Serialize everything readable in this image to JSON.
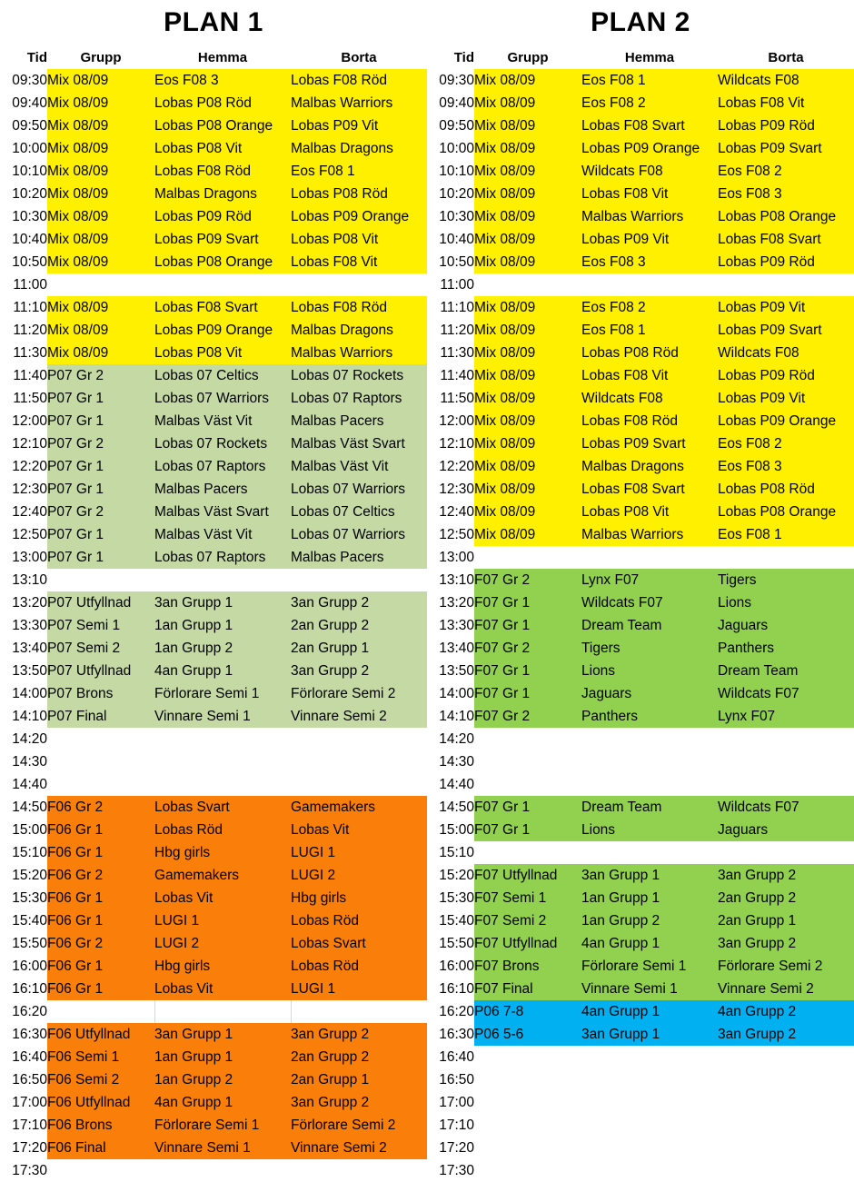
{
  "columns": {
    "tid": "Tid",
    "grupp": "Grupp",
    "hemma": "Hemma",
    "borta": "Borta"
  },
  "colors": {
    "yellow": "#FFF000",
    "sage_green": "#C5D9A5",
    "bright_green": "#92D14F",
    "orange": "#FA7E0A",
    "blue": "#00B0F0",
    "empty": "#FFFFFF"
  },
  "plans": [
    {
      "title": "PLAN 1",
      "rows": [
        {
          "tid": "09:30",
          "grupp": "Mix 08/09",
          "hemma": "Eos F08 3",
          "borta": "Lobas F08 Röd",
          "fill": "yellow"
        },
        {
          "tid": "09:40",
          "grupp": "Mix 08/09",
          "hemma": "Lobas P08 Röd",
          "borta": "Malbas Warriors",
          "fill": "yellow"
        },
        {
          "tid": "09:50",
          "grupp": "Mix 08/09",
          "hemma": "Lobas P08 Orange",
          "borta": "Lobas P09 Vit",
          "fill": "yellow"
        },
        {
          "tid": "10:00",
          "grupp": "Mix 08/09",
          "hemma": "Lobas P08 Vit",
          "borta": "Malbas Dragons",
          "fill": "yellow"
        },
        {
          "tid": "10:10",
          "grupp": "Mix 08/09",
          "hemma": "Lobas F08 Röd",
          "borta": "Eos F08 1",
          "fill": "yellow"
        },
        {
          "tid": "10:20",
          "grupp": "Mix 08/09",
          "hemma": "Malbas Dragons",
          "borta": "Lobas P08 Röd",
          "fill": "yellow"
        },
        {
          "tid": "10:30",
          "grupp": "Mix 08/09",
          "hemma": "Lobas P09 Röd",
          "borta": "Lobas P09 Orange",
          "fill": "yellow"
        },
        {
          "tid": "10:40",
          "grupp": "Mix 08/09",
          "hemma": "Lobas P09 Svart",
          "borta": "Lobas P08 Vit",
          "fill": "yellow"
        },
        {
          "tid": "10:50",
          "grupp": "Mix 08/09",
          "hemma": "Lobas P08 Orange",
          "borta": "Lobas F08 Vit",
          "fill": "yellow"
        },
        {
          "tid": "11:00",
          "grupp": "",
          "hemma": "",
          "borta": "",
          "fill": "none"
        },
        {
          "tid": "11:10",
          "grupp": "Mix 08/09",
          "hemma": "Lobas F08 Svart",
          "borta": "Lobas F08 Röd",
          "fill": "yellow"
        },
        {
          "tid": "11:20",
          "grupp": "Mix 08/09",
          "hemma": "Lobas P09 Orange",
          "borta": "Malbas Dragons",
          "fill": "yellow"
        },
        {
          "tid": "11:30",
          "grupp": "Mix 08/09",
          "hemma": "Lobas P08 Vit",
          "borta": "Malbas Warriors",
          "fill": "yellow"
        },
        {
          "tid": "11:40",
          "grupp": "P07 Gr 2",
          "hemma": "Lobas 07 Celtics",
          "borta": "Lobas 07 Rockets",
          "fill": "sage"
        },
        {
          "tid": "11:50",
          "grupp": "P07 Gr 1",
          "hemma": "Lobas 07 Warriors",
          "borta": "Lobas 07 Raptors",
          "fill": "sage"
        },
        {
          "tid": "12:00",
          "grupp": "P07 Gr 1",
          "hemma": "Malbas Väst Vit",
          "borta": "Malbas Pacers",
          "fill": "sage"
        },
        {
          "tid": "12:10",
          "grupp": "P07 Gr 2",
          "hemma": "Lobas 07 Rockets",
          "borta": "Malbas Väst Svart",
          "fill": "sage"
        },
        {
          "tid": "12:20",
          "grupp": "P07 Gr 1",
          "hemma": "Lobas 07 Raptors",
          "borta": "Malbas Väst Vit",
          "fill": "sage"
        },
        {
          "tid": "12:30",
          "grupp": "P07 Gr 1",
          "hemma": "Malbas Pacers",
          "borta": "Lobas 07 Warriors",
          "fill": "sage"
        },
        {
          "tid": "12:40",
          "grupp": "P07 Gr 2",
          "hemma": "Malbas Väst Svart",
          "borta": "Lobas 07 Celtics",
          "fill": "sage"
        },
        {
          "tid": "12:50",
          "grupp": "P07 Gr 1",
          "hemma": "Malbas Väst Vit",
          "borta": "Lobas 07 Warriors",
          "fill": "sage"
        },
        {
          "tid": "13:00",
          "grupp": "P07 Gr 1",
          "hemma": "Lobas 07 Raptors",
          "borta": "Malbas Pacers",
          "fill": "sage"
        },
        {
          "tid": "13:10",
          "grupp": "",
          "hemma": "",
          "borta": "",
          "fill": "none"
        },
        {
          "tid": "13:20",
          "grupp": "P07 Utfyllnad",
          "hemma": "3an Grupp 1",
          "borta": "3an Grupp 2",
          "fill": "sage"
        },
        {
          "tid": "13:30",
          "grupp": "P07 Semi 1",
          "hemma": "1an Grupp 1",
          "borta": "2an Grupp 2",
          "fill": "sage"
        },
        {
          "tid": "13:40",
          "grupp": "P07 Semi 2",
          "hemma": "1an Grupp 2",
          "borta": "2an Grupp 1",
          "fill": "sage"
        },
        {
          "tid": "13:50",
          "grupp": "P07 Utfyllnad",
          "hemma": "4an Grupp 1",
          "borta": "3an Grupp 2",
          "fill": "sage"
        },
        {
          "tid": "14:00",
          "grupp": "P07 Brons",
          "hemma": "Förlorare Semi 1",
          "borta": "Förlorare Semi 2",
          "fill": "sage"
        },
        {
          "tid": "14:10",
          "grupp": "P07 Final",
          "hemma": "Vinnare Semi 1",
          "borta": "Vinnare Semi 2",
          "fill": "sage"
        },
        {
          "tid": "14:20",
          "grupp": "",
          "hemma": "",
          "borta": "",
          "fill": "none"
        },
        {
          "tid": "14:30",
          "grupp": "",
          "hemma": "",
          "borta": "",
          "fill": "none"
        },
        {
          "tid": "14:40",
          "grupp": "",
          "hemma": "",
          "borta": "",
          "fill": "none"
        },
        {
          "tid": "14:50",
          "grupp": "F06 Gr 2",
          "hemma": "Lobas Svart",
          "borta": "Gamemakers",
          "fill": "orange"
        },
        {
          "tid": "15:00",
          "grupp": "F06 Gr 1",
          "hemma": "Lobas Röd",
          "borta": "Lobas Vit",
          "fill": "orange"
        },
        {
          "tid": "15:10",
          "grupp": "F06 Gr 1",
          "hemma": "Hbg girls",
          "borta": "LUGI 1",
          "fill": "orange"
        },
        {
          "tid": "15:20",
          "grupp": "F06 Gr 2",
          "hemma": "Gamemakers",
          "borta": "LUGI 2",
          "fill": "orange"
        },
        {
          "tid": "15:30",
          "grupp": "F06 Gr 1",
          "hemma": "Lobas Vit",
          "borta": "Hbg girls",
          "fill": "orange"
        },
        {
          "tid": "15:40",
          "grupp": "F06 Gr 1",
          "hemma": "LUGI 1",
          "borta": "Lobas Röd",
          "fill": "orange"
        },
        {
          "tid": "15:50",
          "grupp": "F06 Gr 2",
          "hemma": "LUGI 2",
          "borta": "Lobas Svart",
          "fill": "orange"
        },
        {
          "tid": "16:00",
          "grupp": "F06 Gr 1",
          "hemma": "Hbg girls",
          "borta": "Lobas Röd",
          "fill": "orange"
        },
        {
          "tid": "16:10",
          "grupp": "F06 Gr 1",
          "hemma": "Lobas Vit",
          "borta": "LUGI 1",
          "fill": "orange"
        },
        {
          "tid": "16:20",
          "grupp": "",
          "hemma": "",
          "borta": "",
          "fill": "none",
          "sep": true
        },
        {
          "tid": "16:30",
          "grupp": "F06 Utfyllnad",
          "hemma": "3an Grupp 1",
          "borta": "3an Grupp 2",
          "fill": "orange"
        },
        {
          "tid": "16:40",
          "grupp": "F06 Semi 1",
          "hemma": "1an Grupp 1",
          "borta": "2an Grupp 2",
          "fill": "orange"
        },
        {
          "tid": "16:50",
          "grupp": "F06 Semi 2",
          "hemma": "1an Grupp 2",
          "borta": "2an Grupp 1",
          "fill": "orange"
        },
        {
          "tid": "17:00",
          "grupp": "F06 Utfyllnad",
          "hemma": "4an Grupp 1",
          "borta": "3an Grupp 2",
          "fill": "orange"
        },
        {
          "tid": "17:10",
          "grupp": "F06 Brons",
          "hemma": "Förlorare Semi 1",
          "borta": "Förlorare Semi 2",
          "fill": "orange"
        },
        {
          "tid": "17:20",
          "grupp": "F06 Final",
          "hemma": "Vinnare Semi 1",
          "borta": "Vinnare Semi 2",
          "fill": "orange"
        },
        {
          "tid": "17:30",
          "grupp": "",
          "hemma": "",
          "borta": "",
          "fill": "none"
        }
      ]
    },
    {
      "title": "PLAN 2",
      "rows": [
        {
          "tid": "09:30",
          "grupp": "Mix 08/09",
          "hemma": "Eos F08 1",
          "borta": "Wildcats F08",
          "fill": "yellow"
        },
        {
          "tid": "09:40",
          "grupp": "Mix 08/09",
          "hemma": "Eos F08 2",
          "borta": "Lobas F08 Vit",
          "fill": "yellow"
        },
        {
          "tid": "09:50",
          "grupp": "Mix 08/09",
          "hemma": "Lobas F08 Svart",
          "borta": "Lobas P09 Röd",
          "fill": "yellow"
        },
        {
          "tid": "10:00",
          "grupp": "Mix 08/09",
          "hemma": "Lobas P09 Orange",
          "borta": "Lobas P09 Svart",
          "fill": "yellow"
        },
        {
          "tid": "10:10",
          "grupp": "Mix 08/09",
          "hemma": "Wildcats F08",
          "borta": "Eos F08 2",
          "fill": "yellow"
        },
        {
          "tid": "10:20",
          "grupp": "Mix 08/09",
          "hemma": "Lobas F08 Vit",
          "borta": "Eos F08 3",
          "fill": "yellow"
        },
        {
          "tid": "10:30",
          "grupp": "Mix 08/09",
          "hemma": "Malbas Warriors",
          "borta": "Lobas P08 Orange",
          "fill": "yellow"
        },
        {
          "tid": "10:40",
          "grupp": "Mix 08/09",
          "hemma": "Lobas P09 Vit",
          "borta": "Lobas F08 Svart",
          "fill": "yellow"
        },
        {
          "tid": "10:50",
          "grupp": "Mix 08/09",
          "hemma": "Eos F08 3",
          "borta": "Lobas P09 Röd",
          "fill": "yellow"
        },
        {
          "tid": "11:00",
          "grupp": "",
          "hemma": "",
          "borta": "",
          "fill": "none"
        },
        {
          "tid": "11:10",
          "grupp": "Mix 08/09",
          "hemma": "Eos F08 2",
          "borta": "Lobas P09 Vit",
          "fill": "yellow"
        },
        {
          "tid": "11:20",
          "grupp": "Mix 08/09",
          "hemma": "Eos F08 1",
          "borta": "Lobas P09 Svart",
          "fill": "yellow"
        },
        {
          "tid": "11:30",
          "grupp": "Mix 08/09",
          "hemma": "Lobas P08 Röd",
          "borta": "Wildcats F08",
          "fill": "yellow"
        },
        {
          "tid": "11:40",
          "grupp": "Mix 08/09",
          "hemma": "Lobas F08 Vit",
          "borta": "Lobas P09 Röd",
          "fill": "yellow"
        },
        {
          "tid": "11:50",
          "grupp": "Mix 08/09",
          "hemma": "Wildcats F08",
          "borta": "Lobas P09 Vit",
          "fill": "yellow"
        },
        {
          "tid": "12:00",
          "grupp": "Mix 08/09",
          "hemma": "Lobas F08 Röd",
          "borta": "Lobas P09 Orange",
          "fill": "yellow"
        },
        {
          "tid": "12:10",
          "grupp": "Mix 08/09",
          "hemma": "Lobas P09 Svart",
          "borta": "Eos F08 2",
          "fill": "yellow"
        },
        {
          "tid": "12:20",
          "grupp": "Mix 08/09",
          "hemma": "Malbas Dragons",
          "borta": "Eos F08 3",
          "fill": "yellow"
        },
        {
          "tid": "12:30",
          "grupp": "Mix 08/09",
          "hemma": "Lobas F08 Svart",
          "borta": "Lobas P08 Röd",
          "fill": "yellow"
        },
        {
          "tid": "12:40",
          "grupp": "Mix 08/09",
          "hemma": "Lobas P08 Vit",
          "borta": "Lobas P08 Orange",
          "fill": "yellow"
        },
        {
          "tid": "12:50",
          "grupp": "Mix 08/09",
          "hemma": "Malbas Warriors",
          "borta": "Eos F08 1",
          "fill": "yellow"
        },
        {
          "tid": "13:00",
          "grupp": "",
          "hemma": "",
          "borta": "",
          "fill": "none"
        },
        {
          "tid": "13:10",
          "grupp": "F07 Gr 2",
          "hemma": "Lynx F07",
          "borta": "Tigers",
          "fill": "green"
        },
        {
          "tid": "13:20",
          "grupp": "F07 Gr 1",
          "hemma": "Wildcats F07",
          "borta": "Lions",
          "fill": "green"
        },
        {
          "tid": "13:30",
          "grupp": "F07 Gr 1",
          "hemma": "Dream Team",
          "borta": "Jaguars",
          "fill": "green"
        },
        {
          "tid": "13:40",
          "grupp": "F07 Gr 2",
          "hemma": "Tigers",
          "borta": "Panthers",
          "fill": "green"
        },
        {
          "tid": "13:50",
          "grupp": "F07 Gr 1",
          "hemma": "Lions",
          "borta": "Dream Team",
          "fill": "green"
        },
        {
          "tid": "14:00",
          "grupp": "F07 Gr 1",
          "hemma": "Jaguars",
          "borta": "Wildcats F07",
          "fill": "green"
        },
        {
          "tid": "14:10",
          "grupp": "F07 Gr 2",
          "hemma": "Panthers",
          "borta": "Lynx F07",
          "fill": "green"
        },
        {
          "tid": "14:20",
          "grupp": "",
          "hemma": "",
          "borta": "",
          "fill": "none"
        },
        {
          "tid": "14:30",
          "grupp": "",
          "hemma": "",
          "borta": "",
          "fill": "none"
        },
        {
          "tid": "14:40",
          "grupp": "",
          "hemma": "",
          "borta": "",
          "fill": "none"
        },
        {
          "tid": "14:50",
          "grupp": "F07 Gr 1",
          "hemma": "Dream Team",
          "borta": "Wildcats F07",
          "fill": "green"
        },
        {
          "tid": "15:00",
          "grupp": "F07 Gr 1",
          "hemma": "Lions",
          "borta": "Jaguars",
          "fill": "green"
        },
        {
          "tid": "15:10",
          "grupp": "",
          "hemma": "",
          "borta": "",
          "fill": "none"
        },
        {
          "tid": "15:20",
          "grupp": "F07 Utfyllnad",
          "hemma": "3an Grupp 1",
          "borta": "3an Grupp 2",
          "fill": "green"
        },
        {
          "tid": "15:30",
          "grupp": "F07 Semi 1",
          "hemma": "1an Grupp 1",
          "borta": "2an Grupp 2",
          "fill": "green"
        },
        {
          "tid": "15:40",
          "grupp": "F07 Semi 2",
          "hemma": "1an Grupp 2",
          "borta": "2an Grupp 1",
          "fill": "green"
        },
        {
          "tid": "15:50",
          "grupp": "F07 Utfyllnad",
          "hemma": "4an Grupp 1",
          "borta": "3an Grupp 2",
          "fill": "green"
        },
        {
          "tid": "16:00",
          "grupp": "F07 Brons",
          "hemma": "Förlorare Semi 1",
          "borta": "Förlorare Semi 2",
          "fill": "green"
        },
        {
          "tid": "16:10",
          "grupp": "F07 Final",
          "hemma": "Vinnare Semi 1",
          "borta": "Vinnare Semi 2",
          "fill": "green"
        },
        {
          "tid": "16:20",
          "grupp": "P06 7-8",
          "hemma": "4an Grupp 1",
          "borta": "4an Grupp 2",
          "fill": "blue"
        },
        {
          "tid": "16:30",
          "grupp": "P06 5-6",
          "hemma": "3an Grupp 1",
          "borta": "3an Grupp 2",
          "fill": "blue"
        },
        {
          "tid": "16:40",
          "grupp": "",
          "hemma": "",
          "borta": "",
          "fill": "none"
        },
        {
          "tid": "16:50",
          "grupp": "",
          "hemma": "",
          "borta": "",
          "fill": "none"
        },
        {
          "tid": "17:00",
          "grupp": "",
          "hemma": "",
          "borta": "",
          "fill": "none"
        },
        {
          "tid": "17:10",
          "grupp": "",
          "hemma": "",
          "borta": "",
          "fill": "none"
        },
        {
          "tid": "17:20",
          "grupp": "",
          "hemma": "",
          "borta": "",
          "fill": "none"
        },
        {
          "tid": "17:30",
          "grupp": "",
          "hemma": "",
          "borta": "",
          "fill": "none"
        }
      ]
    }
  ]
}
